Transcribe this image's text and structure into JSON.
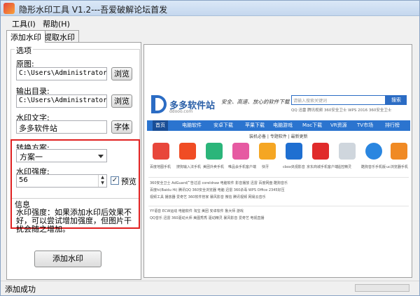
{
  "window": {
    "title": "隐形水印工具 V1.2---吾爱破解论坛首发"
  },
  "menu": {
    "tools": "工具(I)",
    "help": "帮助(H)"
  },
  "tabs": [
    {
      "label": "添加水印"
    },
    {
      "label": "提取水印"
    }
  ],
  "options": {
    "group_label": "选项",
    "source_label": "原图:",
    "source_value": "C:\\Users\\Administrator\\Desk",
    "browse1": "浏览",
    "output_label": "输出目录:",
    "output_value": "C:\\Users\\Administrator\\Desk",
    "browse2": "浏览",
    "watermark_text_label": "水印文字:",
    "watermark_text_value": "多多软件站",
    "font_button": "字体",
    "scheme_label": "转换方案:",
    "scheme_value": "方案一",
    "strength_label": "水印强度:",
    "strength_value": "56",
    "preview_label": "预览",
    "preview_checked": true
  },
  "info": {
    "group_label": "信息",
    "text": "水印强度：如果添加水印后效果不好，可以尝试增加强度，但图片干扰会随之增加。"
  },
  "add_button": "添加水印",
  "status": {
    "text": "添加成功"
  },
  "preview_site": {
    "logo_text": "多多软件站",
    "logo_sub": "ddooo.com",
    "slogan": "安全、高速、放心的软件下载",
    "search_placeholder": "请输入搜索关键词",
    "search_button": "搜索",
    "hot_links": "QQ  迅雷  腾讯视频  360安全卫士  WPS 2016  360安全卫士",
    "nav": [
      "首页",
      "电脑软件",
      "安卓下载",
      "苹果下载",
      "电脑游戏",
      "Mac下载",
      "VR资源",
      "TV市场",
      "排行榜"
    ],
    "subnav": "装机必备  |  专题软件  |  最新更新",
    "apps": [
      {
        "name": "百度地图手机",
        "color": "#e8463b"
      },
      {
        "name": "搜狗输入法手机",
        "color": "#f04c24"
      },
      {
        "name": "美团外卖手机",
        "color": "#2bb57a"
      },
      {
        "name": "唯品会手机客户端",
        "color": "#e65aa2"
      },
      {
        "name": "快牙",
        "color": "#f5a623"
      },
      {
        "name": "cbox央视影音",
        "color": "#1f6fd1"
      },
      {
        "name": "京东商城手机客户端",
        "color": "#e02b2b"
      },
      {
        "name": "遥控精灵",
        "color": "#cfd6dd"
      },
      {
        "name": "酷狗音乐手机版",
        "color": "#2a86e0"
      },
      {
        "name": "uc浏览器手机",
        "color": "#f08a24"
      }
    ],
    "lines": [
      "360安全卫士  AdGuard广告过滤  coreldraw  电脑软件  影音播放  迅雷  百度网盘  酷狗音乐",
      "百度hi(Baidu Hi)  腾讯QQ  360安全浏览器  电脑  迅雷  360杀毒  WPS Office  2345好压",
      "视频工具  播放器  爱奇艺  360软件管家  暴风影音  微信  腾讯视频  网易云音乐",
      "YY语音  ECW运动  电脑软件  淘宝  美团  安卓软件  鲁大师  游戏",
      "QQ音乐  迅雷  360驱动大师  美图秀秀  驱动精灵  暴风影音  爱奇艺  电视直播"
    ]
  }
}
